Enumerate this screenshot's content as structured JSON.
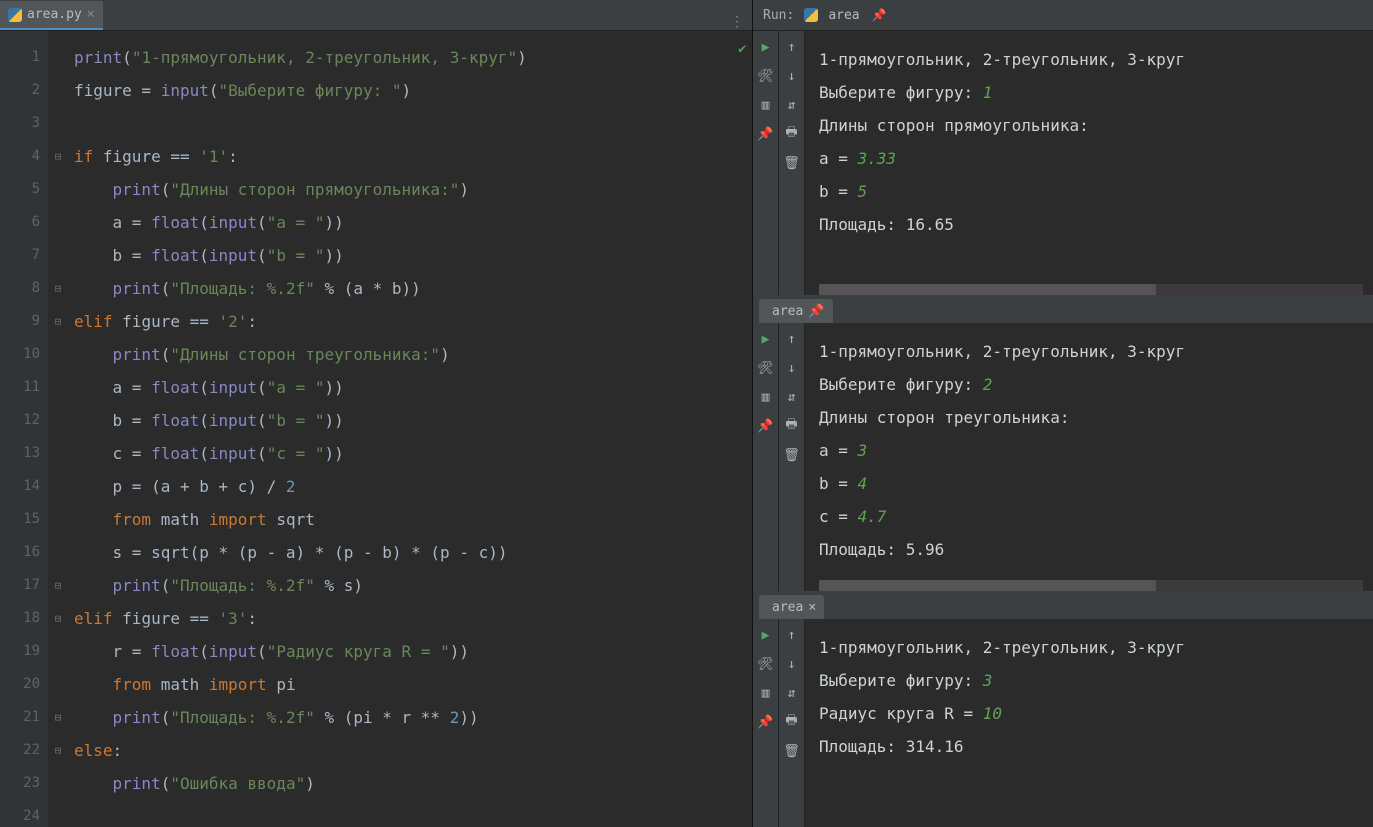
{
  "editor": {
    "tab": {
      "filename": "area.py"
    },
    "gutter": [
      "1",
      "2",
      "3",
      "4",
      "5",
      "6",
      "7",
      "8",
      "9",
      "10",
      "11",
      "12",
      "13",
      "14",
      "15",
      "16",
      "17",
      "18",
      "19",
      "20",
      "21",
      "22",
      "23",
      "24"
    ],
    "fold": [
      "",
      "",
      "",
      "⊟",
      "",
      "",
      "",
      "⊟",
      "⊟",
      "",
      "",
      "",
      "",
      "",
      "",
      "",
      "⊟",
      "⊟",
      "",
      "",
      "⊟",
      "⊟",
      "",
      ""
    ],
    "code": {
      "l1": {
        "a": "print",
        "b": "(",
        "c": "\"1-прямоугольник, 2-треугольник, 3-круг\"",
        "d": ")"
      },
      "l2": {
        "a": "figure = ",
        "b": "input",
        "c": "(",
        "d": "\"Выберите фигуру: \"",
        "e": ")"
      },
      "l4": {
        "a": "if ",
        "b": "figure == ",
        "c": "'1'",
        "d": ":"
      },
      "l5": {
        "a": "print",
        "b": "(",
        "c": "\"Длины сторон прямоугольника:\"",
        "d": ")"
      },
      "l6": {
        "a": "a = ",
        "b": "float",
        "c": "(",
        "d": "input",
        "e": "(",
        "f": "\"a = \"",
        "g": "))"
      },
      "l7": {
        "a": "b = ",
        "b": "float",
        "c": "(",
        "d": "input",
        "e": "(",
        "f": "\"b = \"",
        "g": "))"
      },
      "l8": {
        "a": "print",
        "b": "(",
        "c": "\"Площадь: %.2f\" ",
        "d": "% (a * b))"
      },
      "l9": {
        "a": "elif ",
        "b": "figure == ",
        "c": "'2'",
        "d": ":"
      },
      "l10": {
        "a": "print",
        "b": "(",
        "c": "\"Длины сторон треугольника:\"",
        "d": ")"
      },
      "l11": {
        "a": "a = ",
        "b": "float",
        "c": "(",
        "d": "input",
        "e": "(",
        "f": "\"a = \"",
        "g": "))"
      },
      "l12": {
        "a": "b = ",
        "b": "float",
        "c": "(",
        "d": "input",
        "e": "(",
        "f": "\"b = \"",
        "g": "))"
      },
      "l13": {
        "a": "c = ",
        "b": "float",
        "c": "(",
        "d": "input",
        "e": "(",
        "f": "\"c = \"",
        "g": "))"
      },
      "l14": {
        "a": "p = (a + b + c) / ",
        "b": "2"
      },
      "l15": {
        "a": "from ",
        "b": "math ",
        "c": "import ",
        "d": "sqrt"
      },
      "l16": {
        "a": "s = sqrt(p * (p - a) * (p - b) * (p - c))"
      },
      "l17": {
        "a": "print",
        "b": "(",
        "c": "\"Площадь: %.2f\" ",
        "d": "% s)"
      },
      "l18": {
        "a": "elif ",
        "b": "figure == ",
        "c": "'3'",
        "d": ":"
      },
      "l19": {
        "a": "r = ",
        "b": "float",
        "c": "(",
        "d": "input",
        "e": "(",
        "f": "\"Радиус круга R = \"",
        "g": "))"
      },
      "l20": {
        "a": "from ",
        "b": "math ",
        "c": "import ",
        "d": "pi"
      },
      "l21": {
        "a": "print",
        "b": "(",
        "c": "\"Площадь: %.2f\" ",
        "d": "% (pi * r ** ",
        "e": "2",
        "f": "))"
      },
      "l22": {
        "a": "else",
        "b": ":"
      },
      "l23": {
        "a": "print",
        "b": "(",
        "c": "\"Ошибка ввода\"",
        "d": ")"
      }
    }
  },
  "run": {
    "label": "Run:",
    "config": "area",
    "blocks": [
      {
        "tab": "area",
        "pinned": true,
        "lines": [
          {
            "t": "1-прямоугольник, 2-треугольник, 3-круг"
          },
          {
            "t": "Выберите фигуру: ",
            "i": "1"
          },
          {
            "t": "Длины сторон прямоугольника:"
          },
          {
            "t": "a = ",
            "i": "3.33"
          },
          {
            "t": "b = ",
            "i": "5"
          },
          {
            "t": "Площадь: 16.65"
          }
        ]
      },
      {
        "tab": "area",
        "pinned": true,
        "lines": [
          {
            "t": "1-прямоугольник, 2-треугольник, 3-круг"
          },
          {
            "t": "Выберите фигуру: ",
            "i": "2"
          },
          {
            "t": "Длины сторон треугольника:"
          },
          {
            "t": "a = ",
            "i": "3"
          },
          {
            "t": "b = ",
            "i": "4"
          },
          {
            "t": "c = ",
            "i": "4.7"
          },
          {
            "t": "Площадь: 5.96"
          }
        ]
      },
      {
        "tab": "area",
        "pinned": false,
        "lines": [
          {
            "t": "1-прямоугольник, 2-треугольник, 3-круг"
          },
          {
            "t": "Выберите фигуру: ",
            "i": "3"
          },
          {
            "t": "Радиус круга R = ",
            "i": "10"
          },
          {
            "t": "Площадь: 314.16"
          }
        ]
      }
    ]
  }
}
